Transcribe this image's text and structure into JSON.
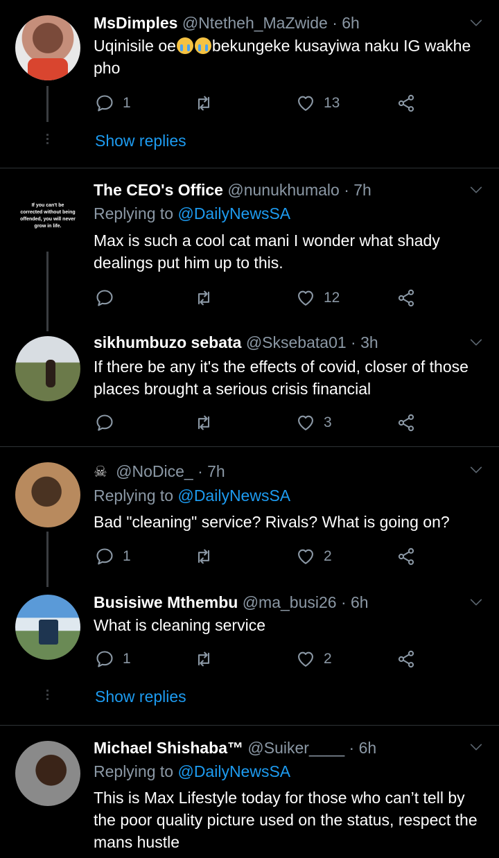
{
  "replying_prefix": "Replying to",
  "show_replies_label": "Show replies",
  "accent_color": "#1d9bf0",
  "tweets": [
    {
      "name": "MsDimples",
      "handle": "@Ntetheh_MaZwide",
      "time": "· 6h",
      "text_before": "Uqinisile oe",
      "emoji": "crying-face-emoji",
      "text_after": "bekungeke kusayiwa naku IG wakhe pho",
      "reply_count": "1",
      "like_count": "13"
    },
    {
      "name": "The CEO's Office",
      "handle": "@nunukhumalo",
      "time": "· 7h",
      "replying_to": "@DailyNewsSA",
      "text": "Max is such a cool cat mani I wonder what shady dealings put him up to this.",
      "avatar_text": "If you can't be corrected without being offended, you will never grow in life.",
      "like_count": "12"
    },
    {
      "name": "sikhumbuzo sebata",
      "handle": "@Sksebata01",
      "time": "· 3h",
      "text": "If there be any it's the effects of covid, closer of those places brought a serious crisis financial",
      "like_count": "3"
    },
    {
      "name": "",
      "name_icon": "skull-emoji",
      "handle": "@NoDice_",
      "time": "· 7h",
      "replying_to": "@DailyNewsSA",
      "text": "Bad \"cleaning\" service? Rivals? What is going on?",
      "reply_count": "1",
      "like_count": "2"
    },
    {
      "name": "Busisiwe Mthembu",
      "handle": "@ma_busi26",
      "time": "· 6h",
      "text": "What is cleaning service",
      "reply_count": "1",
      "like_count": "2"
    },
    {
      "name": "Michael Shishaba™",
      "handle": "@Suiker____",
      "time": "· 6h",
      "replying_to": "@DailyNewsSA",
      "text": "This is Max Lifestyle today for those who can’t tell by the poor quality picture used on the status, respect the mans hustle"
    }
  ]
}
